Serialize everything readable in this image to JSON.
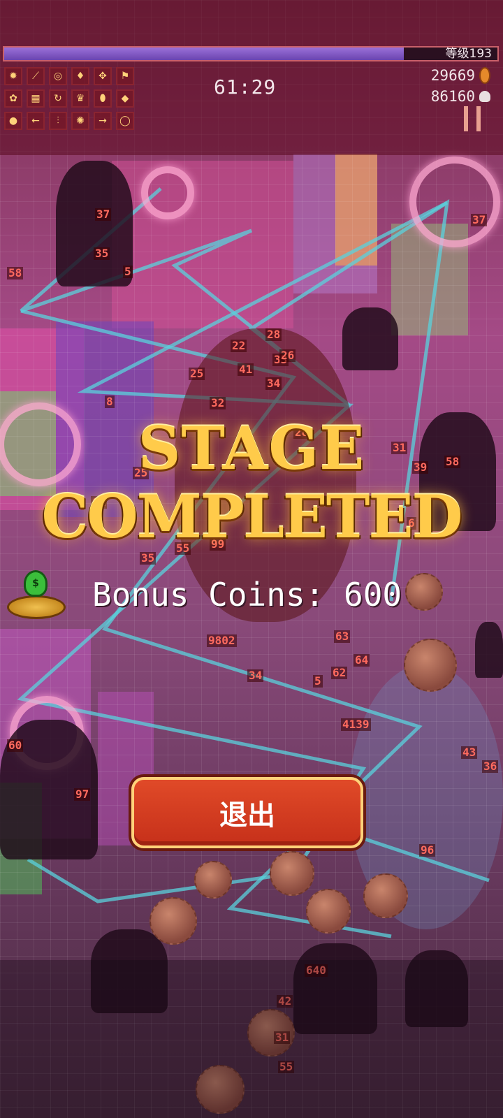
{
  "hud": {
    "level_label": "等级193",
    "xp_fraction": 0.81,
    "timer": "61:29",
    "coins": "29669",
    "kills": "86160",
    "skills": [
      "✹",
      "⟋",
      "◎",
      "♦",
      "✥",
      "⚑",
      "✿",
      "▦",
      "↻",
      "♛",
      "⬮",
      "◆",
      "●",
      "←",
      "⫶",
      "✺",
      "→",
      "◯"
    ]
  },
  "overlay": {
    "title_line1": "STAGE",
    "title_line2": "COMPLETED",
    "bonus_text": "Bonus Coins: 600",
    "bag_glyph": "$",
    "exit_label": "退出"
  },
  "damage_numbers": [
    "37",
    "35",
    "5",
    "58",
    "28",
    "22",
    "25",
    "41",
    "33",
    "34",
    "26",
    "32",
    "8",
    "25",
    "31",
    "39",
    "28",
    "55",
    "35",
    "99",
    "9802",
    "63",
    "64",
    "62",
    "34",
    "5",
    "4139",
    "60",
    "97",
    "36",
    "43",
    "96",
    "640",
    "42",
    "31",
    "55",
    "58",
    "37",
    "61",
    "6"
  ],
  "colors": {
    "accent_gold": "#ffcb4a",
    "button_red": "#d63a20",
    "xp_purple": "#7a52c2"
  }
}
